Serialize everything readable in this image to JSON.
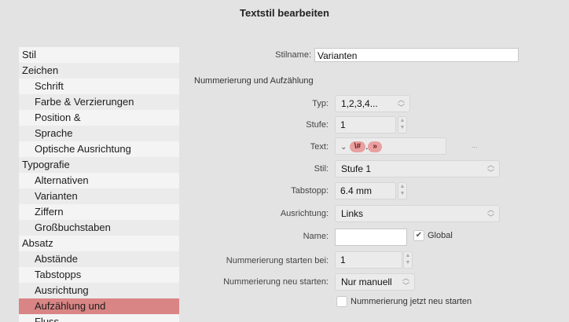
{
  "window": {
    "title": "Textstil bearbeiten"
  },
  "sidebar": {
    "items": [
      {
        "label": "Stil",
        "level": 0
      },
      {
        "label": "Zeichen",
        "level": 0
      },
      {
        "label": "Schrift",
        "level": 1
      },
      {
        "label": "Farbe & Verzierungen",
        "level": 1
      },
      {
        "label": "Position &",
        "level": 1
      },
      {
        "label": "Sprache",
        "level": 1
      },
      {
        "label": "Optische Ausrichtung",
        "level": 1
      },
      {
        "label": "Typografie",
        "level": 0
      },
      {
        "label": "Alternativen",
        "level": 1
      },
      {
        "label": "Varianten",
        "level": 1
      },
      {
        "label": "Ziffern",
        "level": 1
      },
      {
        "label": "Großbuchstaben",
        "level": 1
      },
      {
        "label": "Absatz",
        "level": 0
      },
      {
        "label": "Abstände",
        "level": 1
      },
      {
        "label": "Tabstopps",
        "level": 1
      },
      {
        "label": "Ausrichtung",
        "level": 1
      },
      {
        "label": "Aufzählung und",
        "level": 1,
        "selected": true
      },
      {
        "label": "Fluss",
        "level": 1
      }
    ]
  },
  "form": {
    "stilname_label": "Stilname:",
    "stilname_value": "Varianten",
    "section_title": "Nummerierung und Aufzählung",
    "typ_label": "Typ:",
    "typ_value": "1,2,3,4...",
    "stufe_label": "Stufe:",
    "stufe_value": "1",
    "text_label": "Text:",
    "text_token_number": "\\#",
    "text_separator": ".",
    "text_token_tab": "»",
    "text_more": "...",
    "stil_label": "Stil:",
    "stil_value": "Stufe 1",
    "tabstopp_label": "Tabstopp:",
    "tabstopp_value": "6.4 mm",
    "ausrichtung_label": "Ausrichtung:",
    "ausrichtung_value": "Links",
    "name_label": "Name:",
    "name_value": "",
    "global_label": "Global",
    "global_checked": true,
    "start_label": "Nummerierung starten bei:",
    "start_value": "1",
    "restart_label": "Nummerierung neu starten:",
    "restart_value": "Nur manuell",
    "restart_now_label": "Nummerierung jetzt neu starten",
    "restart_now_checked": false
  },
  "icons": {
    "popup_chevron": "up-down-chevron-icon",
    "stepper": "stepper-arrows-icon",
    "text_dropdown": "chevron-down-icon",
    "checkmark": "checkmark-icon"
  }
}
